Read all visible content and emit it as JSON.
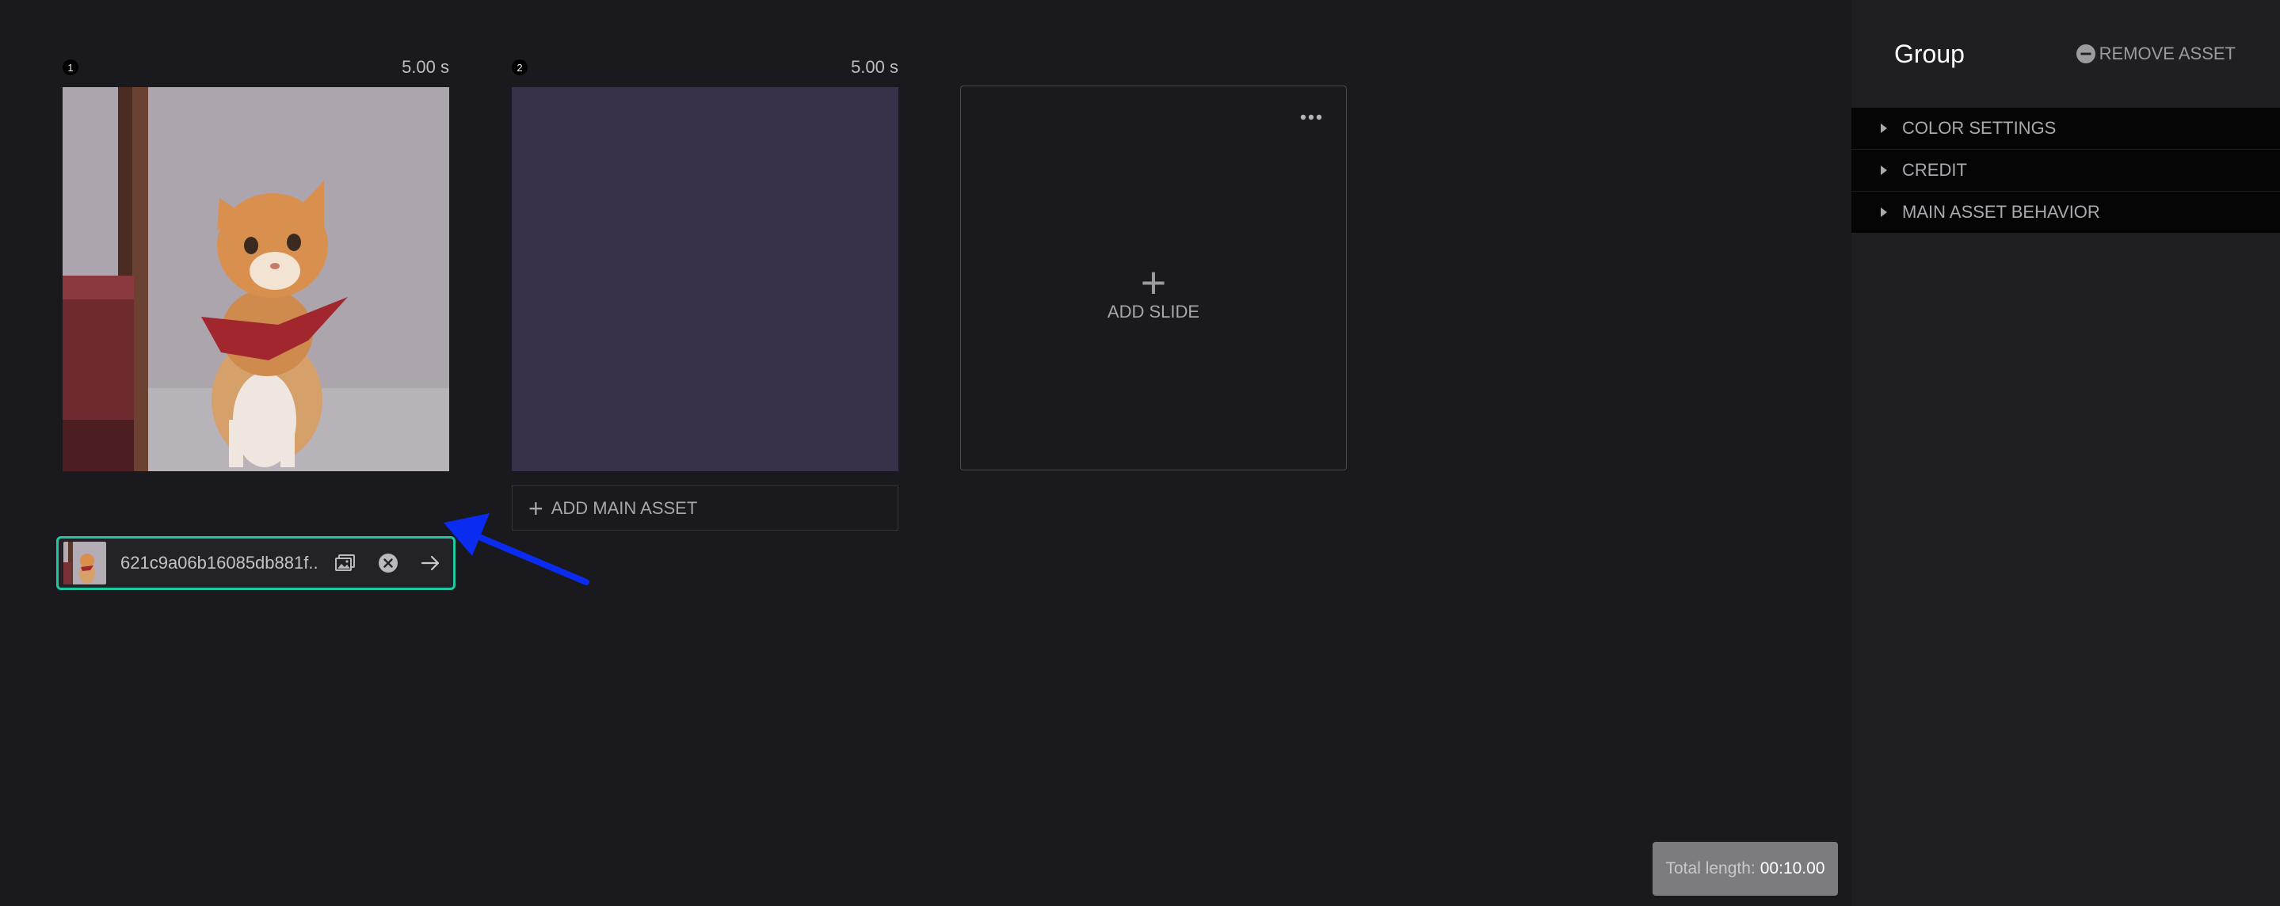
{
  "slides": [
    {
      "number": "1",
      "duration": "5.00 s"
    },
    {
      "number": "2",
      "duration": "5.00 s"
    }
  ],
  "asset": {
    "filename": "621c9a06b16085db881f...",
    "icons": [
      "image-icon",
      "close-circle-icon",
      "arrow-right-icon"
    ]
  },
  "add_main_asset": {
    "plus": "+",
    "label": "ADD MAIN ASSET"
  },
  "add_slide": {
    "plus": "+",
    "label": "ADD SLIDE"
  },
  "total": {
    "label": "Total length:",
    "value": "00:10.00"
  },
  "panel": {
    "title": "Group",
    "remove_label": "REMOVE ASSET",
    "sections": [
      {
        "label": "COLOR SETTINGS"
      },
      {
        "label": "CREDIT"
      },
      {
        "label": "MAIN ASSET BEHAVIOR"
      }
    ]
  },
  "colors": {
    "background": "#1a191e",
    "panel": "#1f1e23",
    "highlight": "#1fc7a1",
    "annotation_arrow": "#0a2bf0",
    "slide2_fill": "#393049"
  }
}
